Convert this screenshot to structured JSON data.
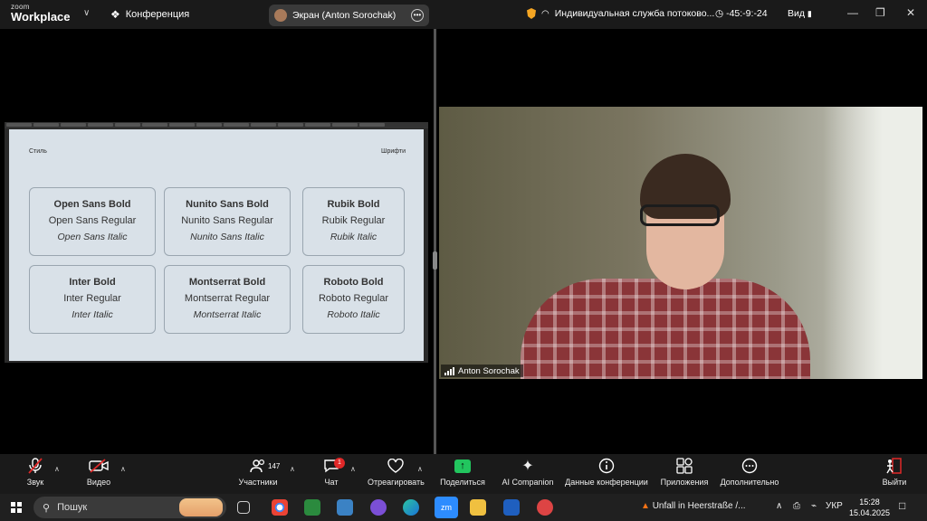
{
  "app": {
    "logo_line1": "zoom",
    "logo_line2": "Workplace",
    "conference_label": "Конференция",
    "share_pill_label": "Экран (Anton Sorochak)",
    "service_label": "Индивидуальная служба потоково...",
    "timer": "-45:-9:-24",
    "view_label": "Вид"
  },
  "slide": {
    "style_label": "Стиль",
    "fonts_label": "Шрифти",
    "cards": [
      {
        "bold": "Open Sans Bold",
        "regular": "Open Sans Regular",
        "italic": "Open Sans Italic"
      },
      {
        "bold": "Nunito Sans Bold",
        "regular": "Nunito Sans Regular",
        "italic": "Nunito Sans Italic"
      },
      {
        "bold": "Rubik Bold",
        "regular": "Rubik Regular",
        "italic": "Rubik Italic"
      },
      {
        "bold": "Inter Bold",
        "regular": "Inter Regular",
        "italic": "Inter Italic"
      },
      {
        "bold": "Montserrat Bold",
        "regular": "Montserrat Regular",
        "italic": "Montserrat Italic"
      },
      {
        "bold": "Roboto Bold",
        "regular": "Roboto Regular",
        "italic": "Roboto Italic"
      }
    ]
  },
  "video": {
    "participant_name": "Anton Sorochak"
  },
  "controls": {
    "audio": "Звук",
    "video": "Видео",
    "participants": "Участники",
    "participants_count": "147",
    "chat": "Чат",
    "chat_badge": "1",
    "react": "Отреагировать",
    "share": "Поделиться",
    "ai": "AI Companion",
    "info": "Данные конференции",
    "apps": "Приложения",
    "more": "Дополнительно",
    "leave": "Выйти"
  },
  "taskbar": {
    "search_placeholder": "Пошук",
    "notification": "Unfall in Heerstraße /...",
    "lang": "УКР",
    "time": "15:28",
    "date": "15.04.2025"
  },
  "colors": {
    "accent_green": "#22c55e",
    "leave_red": "#e02828",
    "slide_bg": "#d9e1e8"
  }
}
